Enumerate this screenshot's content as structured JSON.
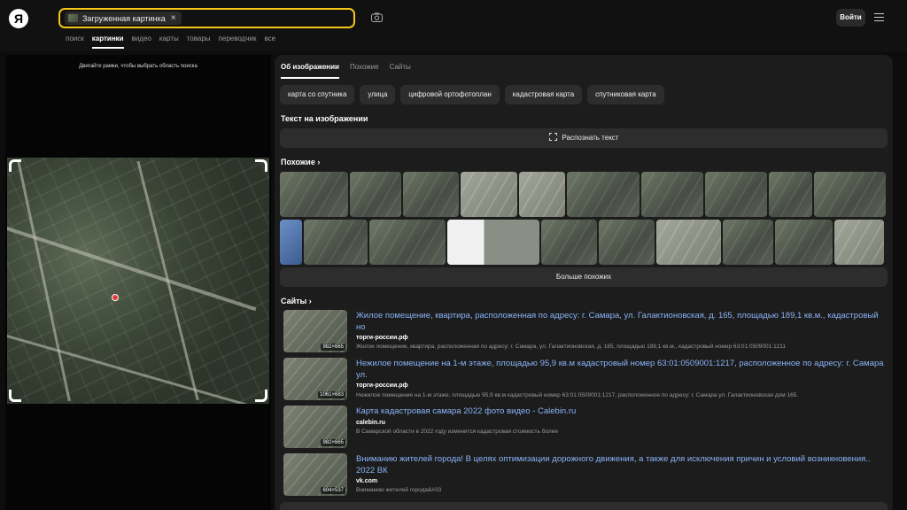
{
  "header": {
    "logo": "Я",
    "search_chip": "Загруженная картинка",
    "chip_close": "×",
    "login_label": "Войти",
    "icons": [
      "camera-icon",
      "menu-icon",
      "close-icon"
    ],
    "accent_color": "#f5c518"
  },
  "nav_tabs": [
    {
      "label": "поиск"
    },
    {
      "label": "картинки",
      "active": true
    },
    {
      "label": "видео"
    },
    {
      "label": "карты"
    },
    {
      "label": "товары"
    },
    {
      "label": "переводчик"
    },
    {
      "label": "все"
    }
  ],
  "left": {
    "hint": "Двигайте рамки, чтобы выбрать область поиска"
  },
  "right": {
    "tabs": [
      {
        "label": "Об изображении",
        "active": true
      },
      {
        "label": "Похожие"
      },
      {
        "label": "Сайты"
      }
    ],
    "tags": [
      "карта со спутника",
      "улица",
      "цифровой ортофотоплан",
      "кадастровая карта",
      "спутниковая карта"
    ],
    "text_section_title": "Текст на изображении",
    "recognize_label": "Распознать текст",
    "similar_title": "Похожие",
    "more_similar_label": "Больше похожих",
    "sites_title": "Сайты",
    "sites": [
      {
        "title": "Жилое помещение, квартира, расположенная по адресу: г. Самара, ул. Галактионовская, д. 165, площадью 189,1 кв.м., кадастровый но",
        "domain": "торги-россии.рф",
        "snippet": "Жилое помещение, квартира, расположенная по адресу: г. Самара, ул. Галактионовская, д. 165, площадью 189,1 кв.м., кадастровый номер 63:01:0509001:1211",
        "size": "982×665"
      },
      {
        "title": "Нежилое помещение на 1-м этаже, площадью 95,9 кв.м кадастровый номер 63:01:0509001:1217, расположенное по адресу: г. Самара ул.",
        "domain": "торги-россии.рф",
        "snippet": "Нежилое помещение на 1-м этаже, площадью 95,9 кв.м кадастровый номер 63:01:0509001:1217, расположенное по адресу: г. Самара ул. Галактионовская дом 165.",
        "size": "1061×683"
      },
      {
        "title": "Карта кадастровая самара 2022 фото видео - Calebin.ru",
        "domain": "calebin.ru",
        "snippet": "В Самарской области в 2022 году изменится кадастровая стоимость более",
        "size": "982×665"
      },
      {
        "title": "Вниманию жителей города! В целях оптимизации дорожного движения, а также для исключения причин и условий возникновения.. 2022 ВК",
        "domain": "vk.com",
        "snippet": "Вниманию жителей города&#33",
        "size": "604×537"
      }
    ]
  }
}
